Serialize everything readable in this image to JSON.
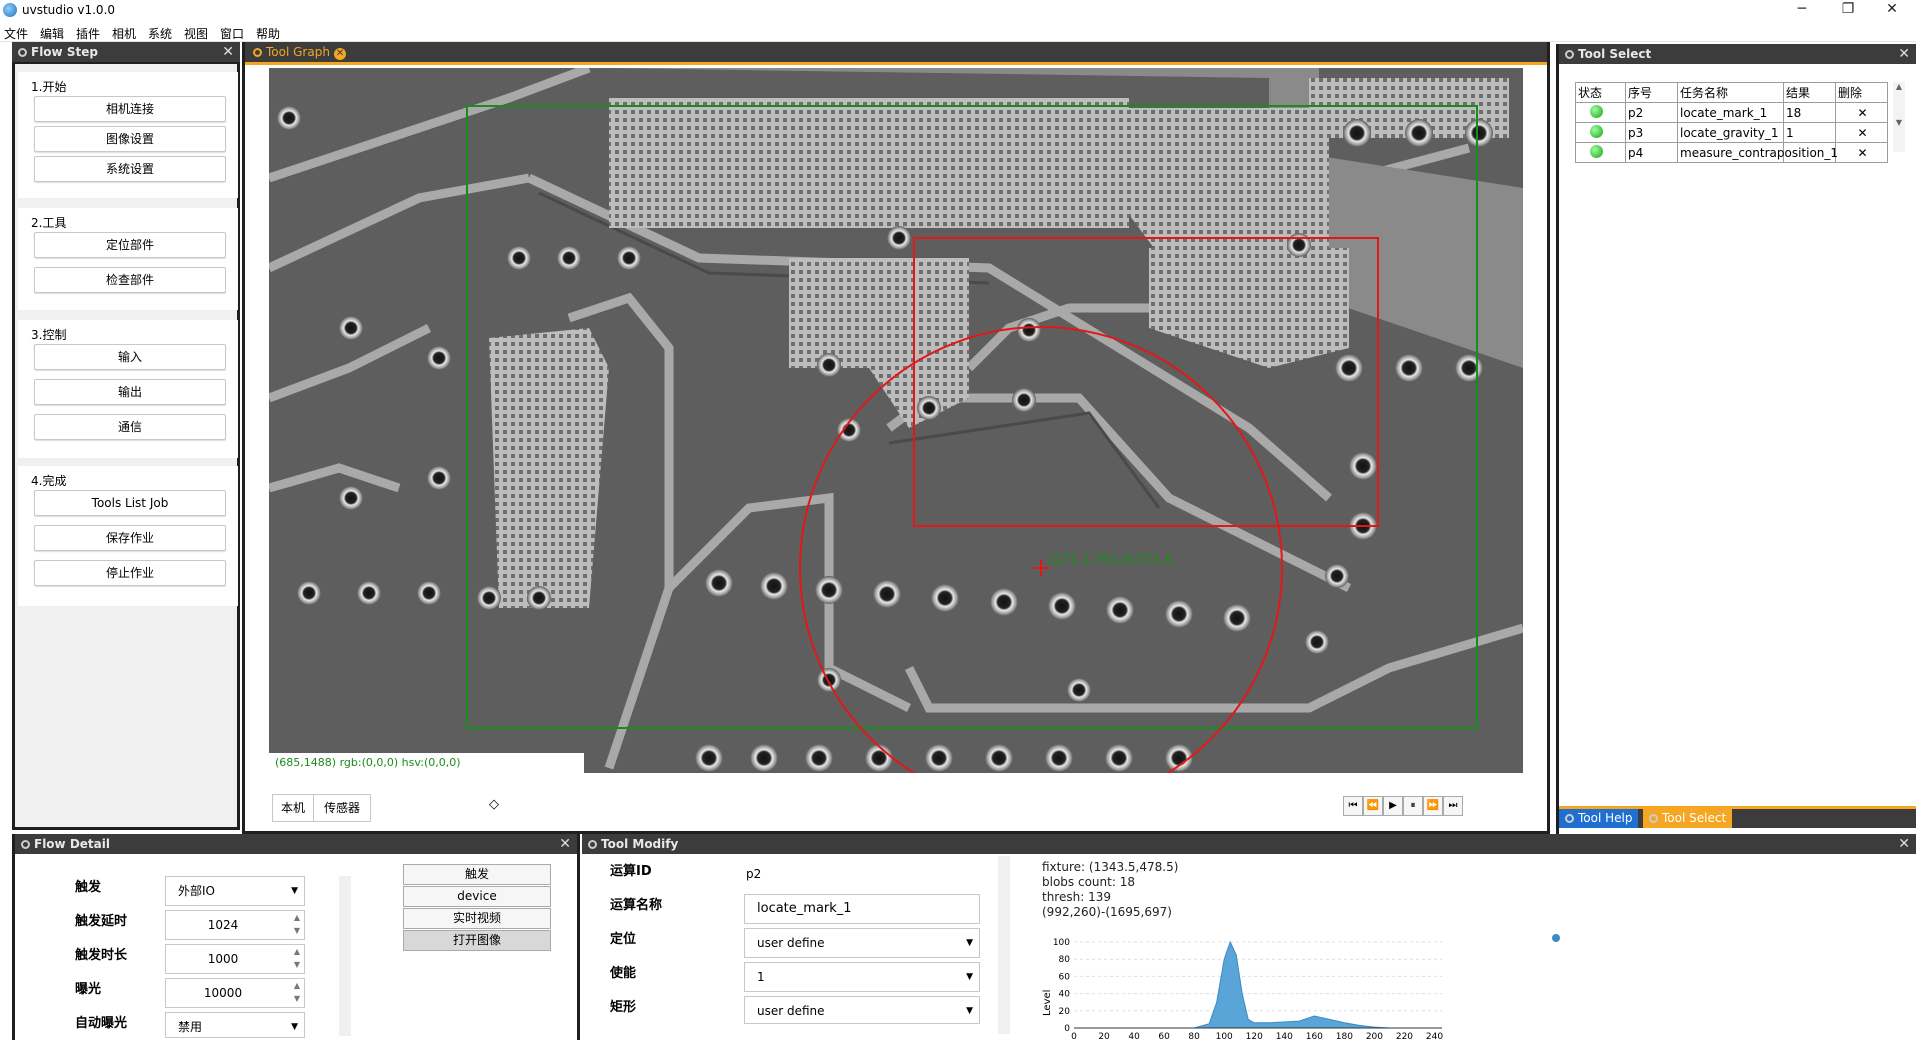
{
  "window": {
    "title": "uvstudio v1.0.0",
    "minimize": "─",
    "restore": "❐",
    "close": "✕"
  },
  "menu": [
    "文件",
    "编辑",
    "插件",
    "相机",
    "系统",
    "视图",
    "窗口",
    "帮助"
  ],
  "flow_step": {
    "title": "Flow Step",
    "groups": [
      {
        "title": "1.开始",
        "buttons": [
          "相机连接",
          "图像设置",
          "系统设置"
        ]
      },
      {
        "title": "2.工具",
        "buttons": [
          "定位部件",
          "检查部件"
        ]
      },
      {
        "title": "3.控制",
        "buttons": [
          "输入",
          "输出",
          "通信"
        ]
      },
      {
        "title": "4.完成",
        "buttons": [
          "Tools List Job",
          "保存作业",
          "停止作业"
        ]
      }
    ]
  },
  "tool_graph": {
    "tab_label": "Tool Graph",
    "overlay_label": "(171.2,761.8)371.6",
    "status_readout": "(685,1488) rgb:(0,0,0) hsv:(0,0,0)",
    "tabs": [
      "本机",
      "传感器"
    ],
    "expand_icon": "◇",
    "playback": [
      "⏮",
      "⏪",
      "▶",
      "⏸",
      "⏩",
      "⏭"
    ]
  },
  "tool_select": {
    "title": "Tool Select",
    "columns": [
      "状态",
      "序号",
      "任务名称",
      "结果",
      "删除"
    ],
    "rows": [
      {
        "id": "p2",
        "name": "locate_mark_1",
        "result": "18",
        "delete": "✕"
      },
      {
        "id": "p3",
        "name": "locate_gravity_1",
        "result": "1",
        "delete": "✕"
      },
      {
        "id": "p4",
        "name": "measure_contraposition_1",
        "result": "",
        "delete": "✕"
      }
    ],
    "bottom_tabs": [
      "Tool Help",
      "Tool Select"
    ]
  },
  "flow_detail": {
    "title": "Flow Detail",
    "fields": [
      {
        "label": "触发",
        "value": "外部IO",
        "kind": "select"
      },
      {
        "label": "触发延时",
        "value": "1024",
        "kind": "spin"
      },
      {
        "label": "触发时长",
        "value": "1000",
        "kind": "spin"
      },
      {
        "label": "曝光",
        "value": "10000",
        "kind": "spin"
      },
      {
        "label": "自动曝光",
        "value": "禁用",
        "kind": "select"
      }
    ],
    "buttons": [
      "触发",
      "device",
      "实时视频",
      "打开图像"
    ]
  },
  "tool_modify": {
    "title": "Tool Modify",
    "fields": [
      {
        "label": "运算ID",
        "value": "p2",
        "kind": "text"
      },
      {
        "label": "运算名称",
        "value": "locate_mark_1",
        "kind": "input"
      },
      {
        "label": "定位",
        "value": "user define",
        "kind": "select"
      },
      {
        "label": "使能",
        "value": "1",
        "kind": "select"
      },
      {
        "label": "矩形",
        "value": "user define",
        "kind": "select"
      }
    ],
    "stats": {
      "fixture": "fixture: (1343.5,478.5)",
      "blobs": "blobs count: 18",
      "thresh": "thresh: 139",
      "range": "(992,260)-(1695,697)"
    },
    "histogram": {
      "ylabel": "Level",
      "y_ticks": [
        "0",
        "20",
        "40",
        "60",
        "80",
        "100"
      ],
      "x_ticks": [
        "0",
        "20",
        "40",
        "60",
        "80",
        "100",
        "120",
        "140",
        "160",
        "180",
        "200",
        "220",
        "240"
      ]
    }
  },
  "chart_data": {
    "type": "area",
    "ylabel": "Level",
    "ylim": [
      0,
      100
    ],
    "xlim": [
      0,
      245
    ],
    "x": [
      0,
      60,
      80,
      90,
      95,
      100,
      104,
      108,
      112,
      116,
      120,
      130,
      150,
      160,
      170,
      180,
      190,
      200,
      210,
      245
    ],
    "y": [
      0,
      0,
      0,
      5,
      30,
      80,
      100,
      85,
      40,
      10,
      6,
      6,
      8,
      14,
      10,
      6,
      3,
      1,
      0,
      0
    ]
  }
}
